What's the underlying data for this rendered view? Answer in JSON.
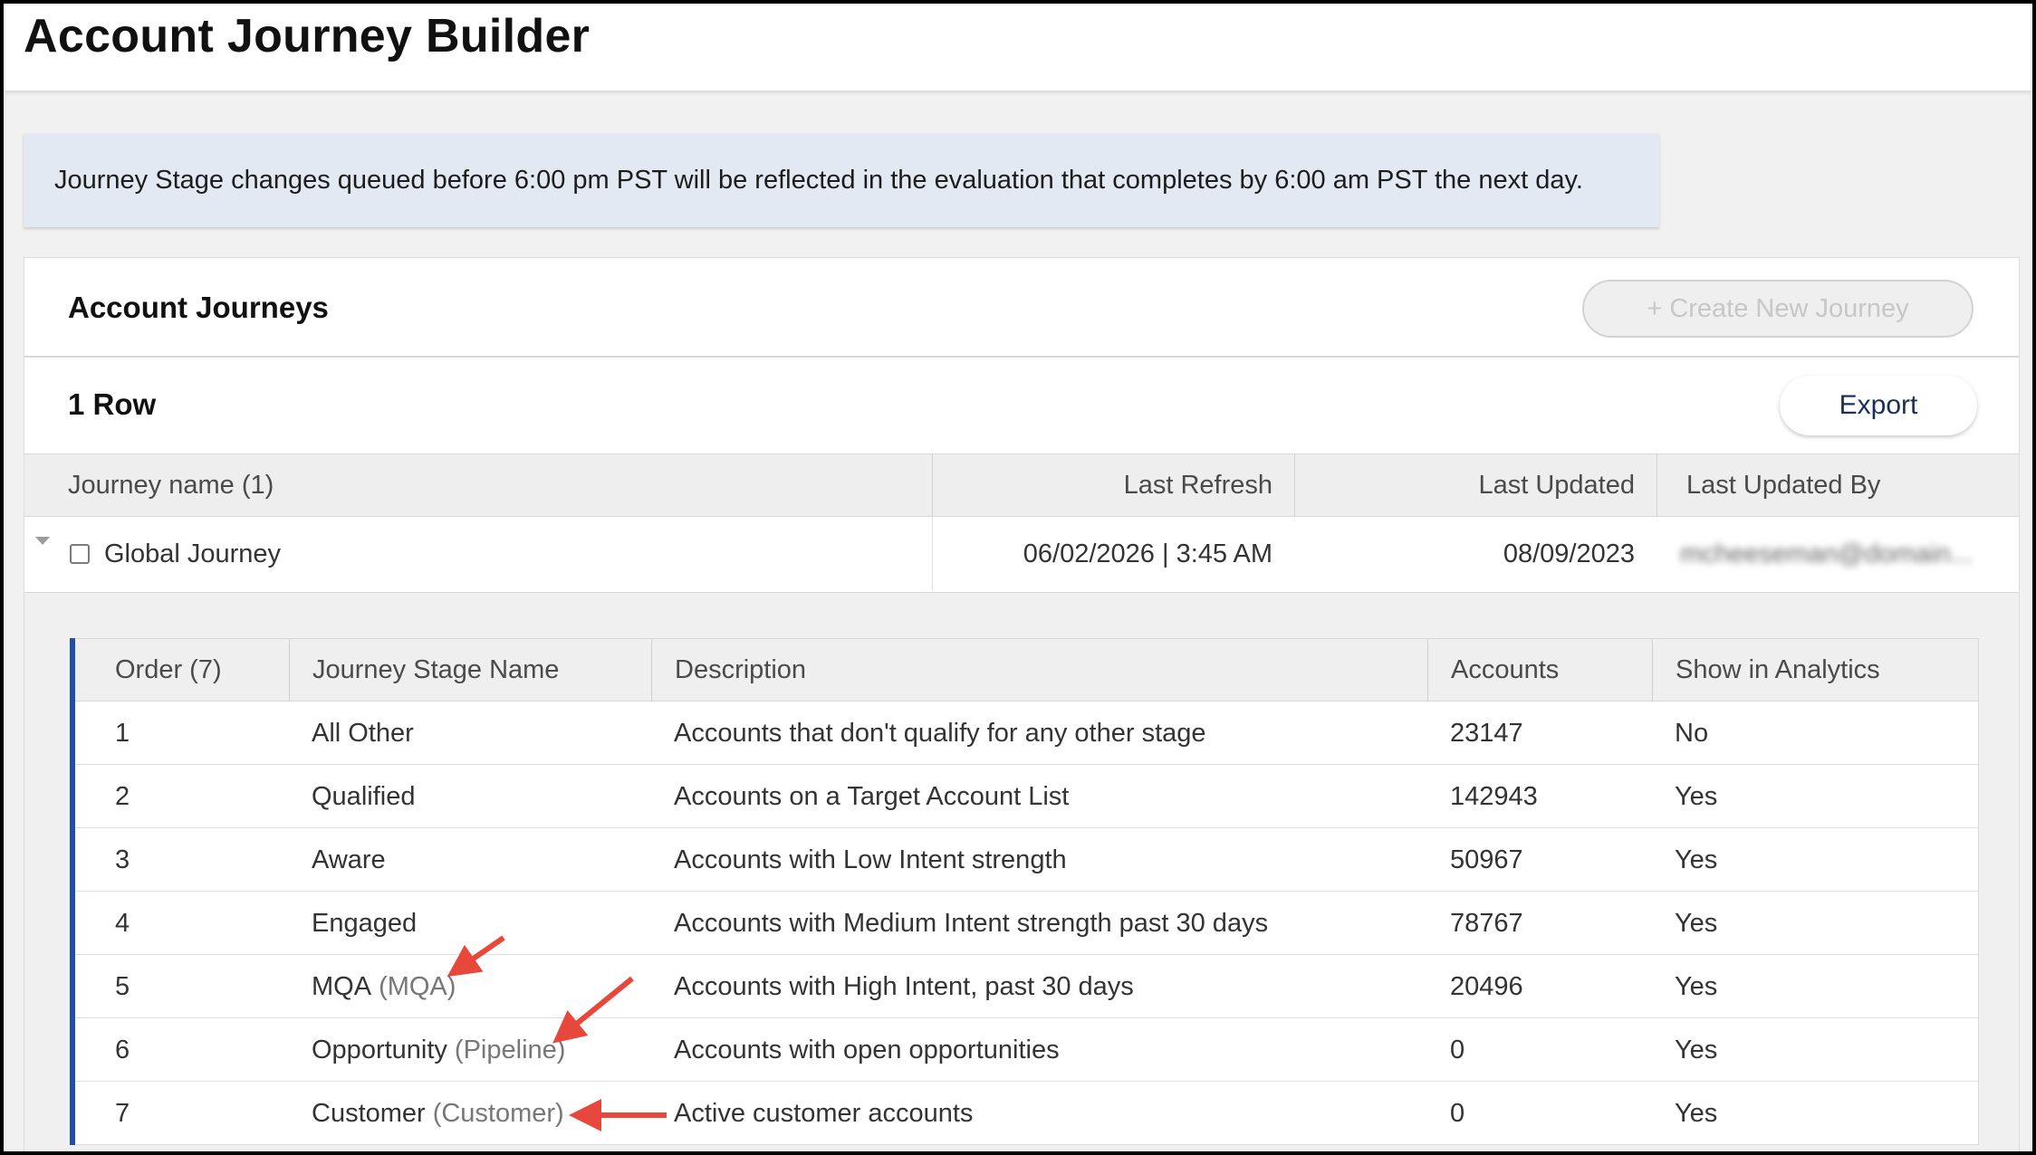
{
  "page": {
    "title": "Account Journey Builder"
  },
  "notice": {
    "text": "Journey Stage changes queued before 6:00 pm PST will be reflected in the evaluation that completes by 6:00 am PST the next day."
  },
  "card": {
    "title": "Account Journeys",
    "create_label": "+ Create New Journey",
    "row_count": "1 Row",
    "export_label": "Export"
  },
  "grid": {
    "headers": {
      "name": "Journey name (1)",
      "last_refresh": "Last Refresh",
      "last_updated": "Last Updated",
      "last_updated_by": "Last Updated By"
    },
    "row": {
      "name": "Global Journey",
      "last_refresh": "06/02/2026 | 3:45 AM",
      "last_updated": "08/09/2023",
      "last_updated_by": "mcheeseman@domain..."
    }
  },
  "stages": {
    "headers": {
      "order": "Order (7)",
      "name": "Journey Stage Name",
      "description": "Description",
      "accounts": "Accounts",
      "analytics": "Show in Analytics"
    },
    "rows": [
      {
        "order": "1",
        "name": "All Other",
        "alias": "",
        "description": "Accounts that don't qualify for any other stage",
        "accounts": "23147",
        "analytics": "No"
      },
      {
        "order": "2",
        "name": "Qualified",
        "alias": "",
        "description": "Accounts on a Target Account List",
        "accounts": "142943",
        "analytics": "Yes"
      },
      {
        "order": "3",
        "name": "Aware",
        "alias": "",
        "description": "Accounts with Low Intent strength",
        "accounts": "50967",
        "analytics": "Yes"
      },
      {
        "order": "4",
        "name": "Engaged",
        "alias": "",
        "description": "Accounts with Medium Intent strength past 30 days",
        "accounts": "78767",
        "analytics": "Yes"
      },
      {
        "order": "5",
        "name": "MQA",
        "alias": "(MQA)",
        "description": "Accounts with High Intent, past 30 days",
        "accounts": "20496",
        "analytics": "Yes"
      },
      {
        "order": "6",
        "name": "Opportunity",
        "alias": "(Pipeline)",
        "description": "Accounts with open opportunities",
        "accounts": "0",
        "analytics": "Yes"
      },
      {
        "order": "7",
        "name": "Customer",
        "alias": "(Customer)",
        "description": "Active customer accounts",
        "accounts": "0",
        "analytics": "Yes"
      }
    ]
  },
  "colors": {
    "accent": "#1f4fa8",
    "annotation": "#e8473c"
  }
}
